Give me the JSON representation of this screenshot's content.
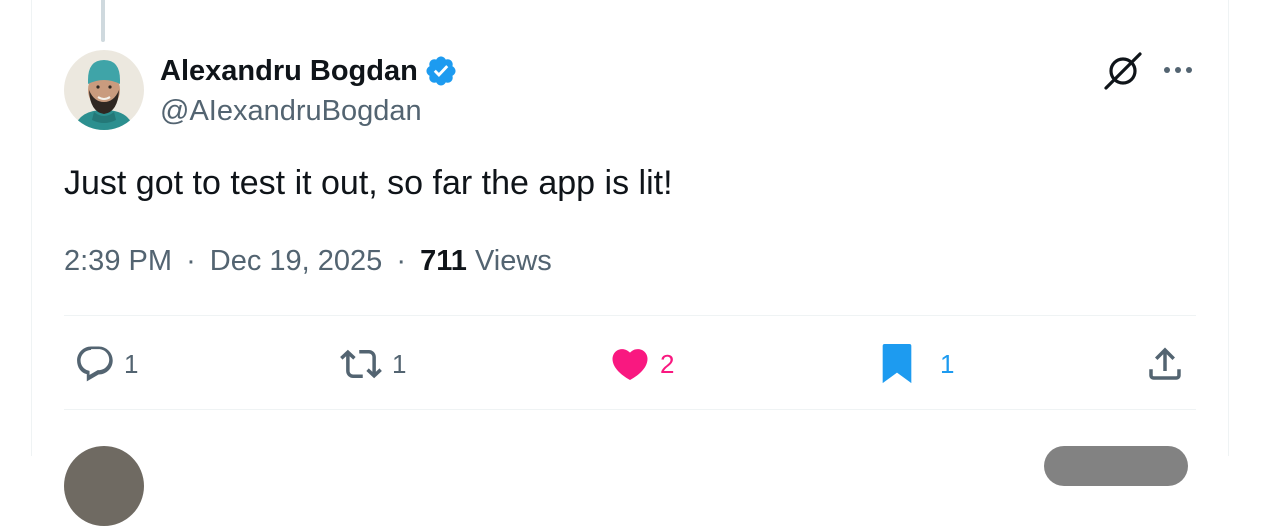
{
  "tweet": {
    "author": {
      "display_name": "Alexandru Bogdan",
      "handle": "@AIexandruBogdan",
      "verified": true,
      "verified_color": "#1d9bf0"
    },
    "text": "Just got to test it out, so far the app is lit!",
    "time": "2:39 PM",
    "separator": "·",
    "date": "Dec 19, 2025",
    "views_count": "711",
    "views_label": "Views",
    "actions": {
      "reply": {
        "icon": "reply-icon",
        "count": "1"
      },
      "retweet": {
        "icon": "retweet-icon",
        "count": "1"
      },
      "like": {
        "icon": "heart-icon",
        "count": "2",
        "active": true,
        "color": "#f91880"
      },
      "bookmark": {
        "icon": "bookmark-icon",
        "count": "1",
        "active": true,
        "color": "#1d9bf0"
      },
      "share": {
        "icon": "share-icon"
      }
    }
  },
  "header_icons": {
    "grok": "grok-icon",
    "more": "more-icon"
  },
  "colors": {
    "text_primary": "#0f1419",
    "text_secondary": "#536471",
    "divider": "#eff3f4",
    "like": "#f91880",
    "accent": "#1d9bf0"
  }
}
